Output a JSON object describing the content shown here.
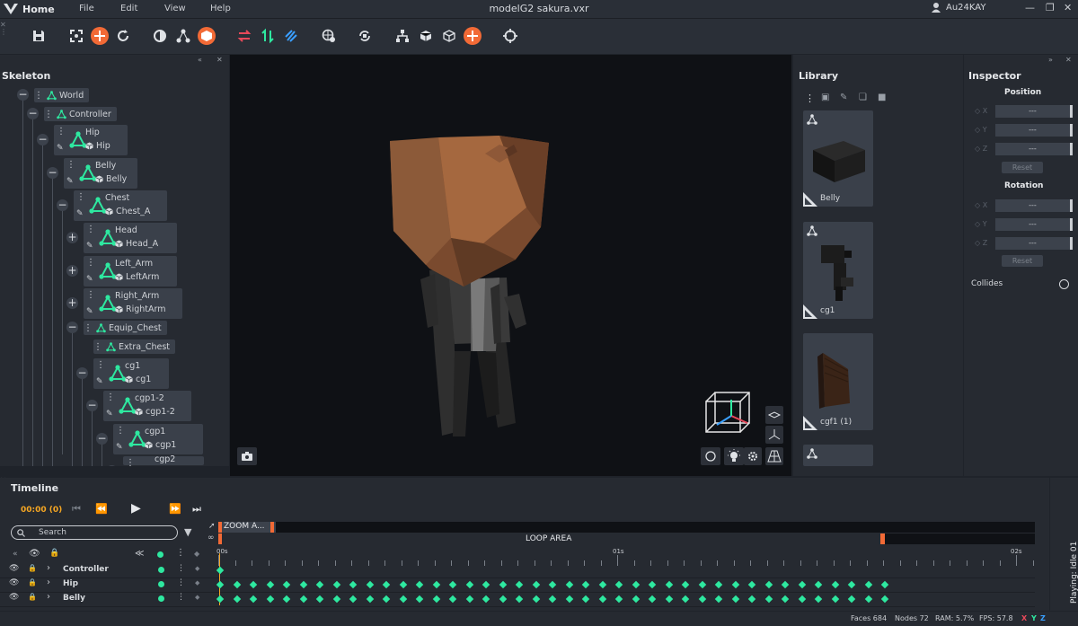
{
  "menubar": {
    "home": "Home",
    "menus": [
      "File",
      "Edit",
      "View",
      "Help"
    ],
    "title": "modelG2 sakura.vxr",
    "user": "Au24KAY"
  },
  "toolbar": {
    "icons": [
      "save-icon",
      "fit-icon",
      "add-bone-icon",
      "refresh-icon",
      "half-circle-icon",
      "hierarchy-icon",
      "box-icon",
      "swap-icon",
      "sort-icon",
      "bolt-icon",
      "globe-icon",
      "rotate-icon",
      "tree-icon",
      "cube-solid-icon",
      "cube-outline-icon",
      "add-icon",
      "target-icon"
    ]
  },
  "skeleton": {
    "title": "Skeleton",
    "nodes": [
      {
        "name": "World"
      },
      {
        "name": "Controller"
      },
      {
        "bone": "Hip",
        "mesh": "Hip"
      },
      {
        "bone": "Belly",
        "mesh": "Belly"
      },
      {
        "bone": "Chest",
        "mesh": "Chest_A"
      },
      {
        "bone": "Head",
        "mesh": "Head_A"
      },
      {
        "bone": "Left_Arm",
        "mesh": "LeftArm"
      },
      {
        "bone": "Right_Arm",
        "mesh": "RightArm"
      },
      {
        "name": "Equip_Chest"
      },
      {
        "name": "Extra_Chest"
      },
      {
        "bone": "cg1",
        "mesh": "cg1"
      },
      {
        "bone": "cgp1-2",
        "mesh": "cgp1-2"
      },
      {
        "bone": "cgp1",
        "mesh": "cgp1"
      },
      {
        "bone": "cgp2",
        "mesh": ""
      }
    ]
  },
  "library": {
    "title": "Library",
    "items": [
      "Belly",
      "cg1",
      "cgf1 (1)",
      ""
    ]
  },
  "inspector": {
    "title": "Inspector",
    "position_label": "Position",
    "rotation_label": "Rotation",
    "axes": [
      "X",
      "Y",
      "Z"
    ],
    "field_value": "---",
    "reset_label": "Reset",
    "collides_label": "Collides"
  },
  "timeline": {
    "title": "Timeline",
    "time": "00:00 (0)",
    "search_placeholder": "Search",
    "zoom_label": "ZOOM A...",
    "loop_label": "LOOP AREA",
    "ticks": [
      "00s",
      "01s",
      "02s"
    ],
    "tracks": [
      {
        "name": "Controller",
        "keyframes": 1
      },
      {
        "name": "Hip",
        "keyframes": 41
      },
      {
        "name": "Belly",
        "keyframes": 41
      }
    ],
    "playing": "Playing: Idle 01"
  },
  "status": {
    "faces": "Faces 684",
    "nodes": "Nodes 72",
    "ram": "RAM: 5.7%",
    "fps": "FPS: 57.8",
    "axis_x": "X",
    "axis_y": "Y",
    "axis_z": "Z"
  },
  "colors": {
    "accent_orange": "#f26a36",
    "bone_green": "#2ee8a0",
    "panel": "#262a31",
    "viewport": "#0f1115"
  }
}
